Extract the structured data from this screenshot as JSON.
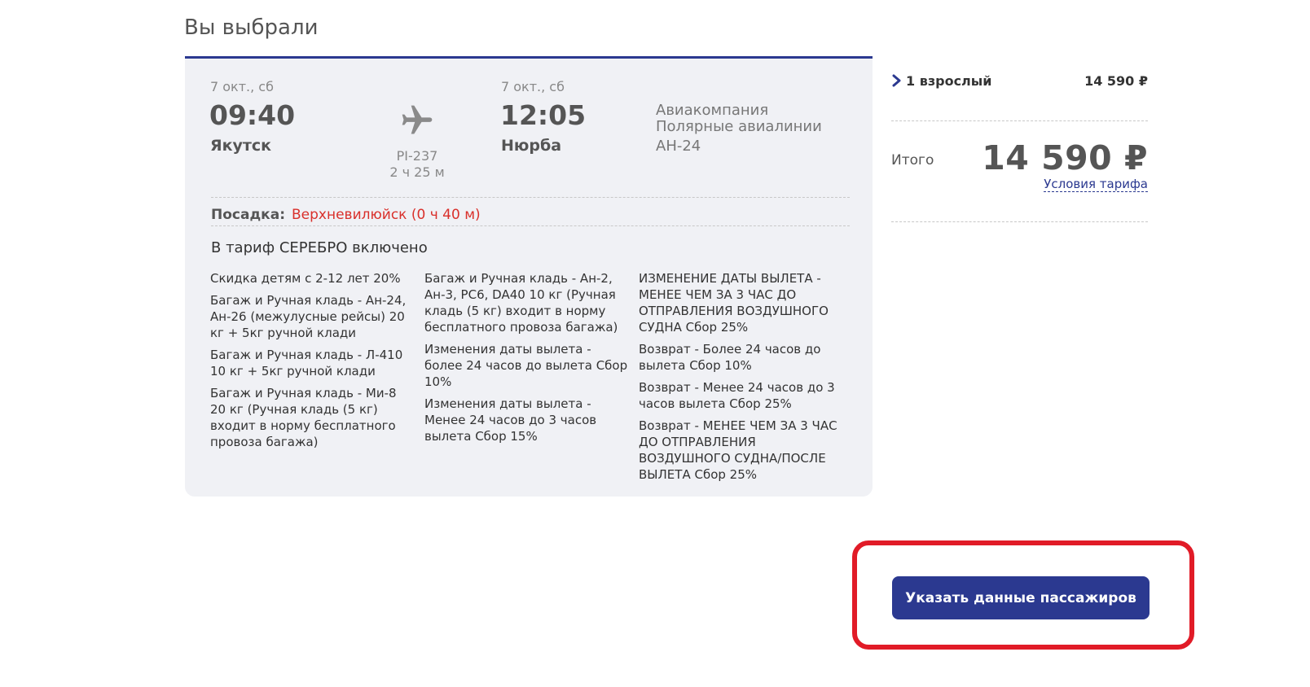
{
  "page": {
    "title": "Вы выбрали"
  },
  "flight": {
    "departure": {
      "date": "7 окт., сб",
      "time": "09:40",
      "city": "Якутск"
    },
    "arrival": {
      "date": "7 окт., сб",
      "time": "12:05",
      "city": "Нюрба"
    },
    "flight_number": "PI-237",
    "duration": "2 ч 25 м",
    "airline_line1": "Авиакомпания",
    "airline_line2": "Полярные авиалинии",
    "aircraft": "АН-24",
    "stopover_label": "Посадка:",
    "stopover_value": "Верхневилюйск (0 ч 40 м)",
    "tariff_heading": "В тариф СЕРЕБРО включено",
    "conditions": [
      [
        "Скидка детям с 2-12 лет 20%",
        "Багаж и Ручная кладь - Ан-24, Ан-26 (межулусные рейсы) 20 кг + 5кг ручной клади",
        "Багаж и Ручная кладь - Л-410 10 кг + 5кг ручной клади",
        "Багаж и Ручная кладь - Ми-8 20 кг (Ручная кладь (5 кг) входит в норму бесплатного провоза багажа)"
      ],
      [
        "Багаж и Ручная кладь - Ан-2, Ан-3, РС6, DA40 10 кг (Ручная кладь (5 кг) входит в норму бесплатного провоза багажа)",
        "Изменения даты вылета - более 24 часов до вылета Сбор 10%",
        "Изменения даты вылета - Менее 24 часов до 3 часов вылета Сбор 15%"
      ],
      [
        "ИЗМЕНЕНИЕ ДАТЫ ВЫЛЕТА - МЕНЕЕ ЧЕМ ЗА 3 ЧАС ДО ОТПРАВЛЕНИЯ ВОЗДУШНОГО СУДНА Сбор 25%",
        "Возврат - Более 24 часов до вылета Сбор 10%",
        "Возврат - Менее 24 часов до 3 часов вылета Сбор 25%",
        "Возврат - МЕНЕЕ ЧЕМ ЗА 3 ЧАС ДО ОТПРАВЛЕНИЯ ВОЗДУШНОГО СУДНА/ПОСЛЕ ВЫЛЕТА Сбор 25%"
      ]
    ]
  },
  "summary": {
    "passenger_label": "1 взрослый",
    "passenger_price": "14 590 ₽",
    "total_label": "Итого",
    "total_value": "14 590 ₽",
    "tariff_link": "Условия тарифа"
  },
  "cta": {
    "label": "Указать данные пассажиров"
  },
  "colors": {
    "brand": "#2b3990",
    "stopover": "#d9302b",
    "highlight": "#e11b27",
    "card_bg": "#f0f1f5"
  }
}
